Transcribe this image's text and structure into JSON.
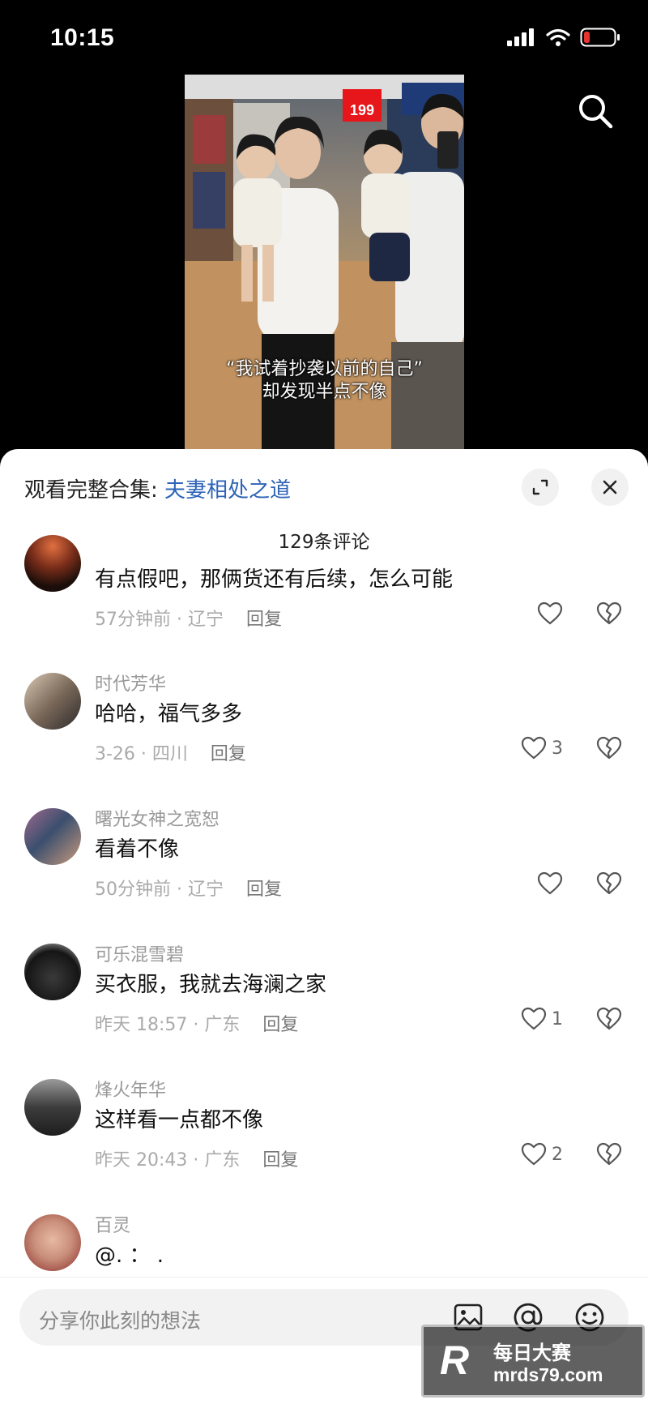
{
  "status_bar": {
    "time": "10:15"
  },
  "video": {
    "sign_text": "199",
    "caption_line1": "“我试着抄袭以前的自己”",
    "caption_line2": "却发现半点不像"
  },
  "sheet": {
    "collection_prefix": "观看完整合集: ",
    "collection_title": "夫妻相处之道",
    "comment_count": "129条评论"
  },
  "comments": [
    {
      "username": "",
      "text": "有点假吧，那俩货还有后续，怎么可能",
      "time_location": "57分钟前 · 辽宁",
      "reply": "回复",
      "likes": ""
    },
    {
      "username": "时代芳华",
      "text": "哈哈，福气多多",
      "time_location": "3-26 · 四川",
      "reply": "回复",
      "likes": "3"
    },
    {
      "username": "曙光女神之宽恕",
      "text": "看着不像",
      "time_location": "50分钟前 · 辽宁",
      "reply": "回复",
      "likes": ""
    },
    {
      "username": "可乐混雪碧",
      "text": "买衣服，我就去海澜之家",
      "time_location": "昨天 18:57 · 广东",
      "reply": "回复",
      "likes": "1"
    },
    {
      "username": "烽火年华",
      "text": "这样看一点都不像",
      "time_location": "昨天 20:43 · 广东",
      "reply": "回复",
      "likes": "2"
    },
    {
      "username": "百灵",
      "text": "@. ： .",
      "time_location": "",
      "reply": "",
      "likes": ""
    }
  ],
  "input": {
    "placeholder": "分享你此刻的想法"
  },
  "watermark": {
    "logo": "R",
    "line1": "每日大赛",
    "line2": "mrds79.com"
  },
  "colors": {
    "link": "#2e64b8",
    "sheet_bg": "#ffffff",
    "battery_low": "#e8342f"
  }
}
